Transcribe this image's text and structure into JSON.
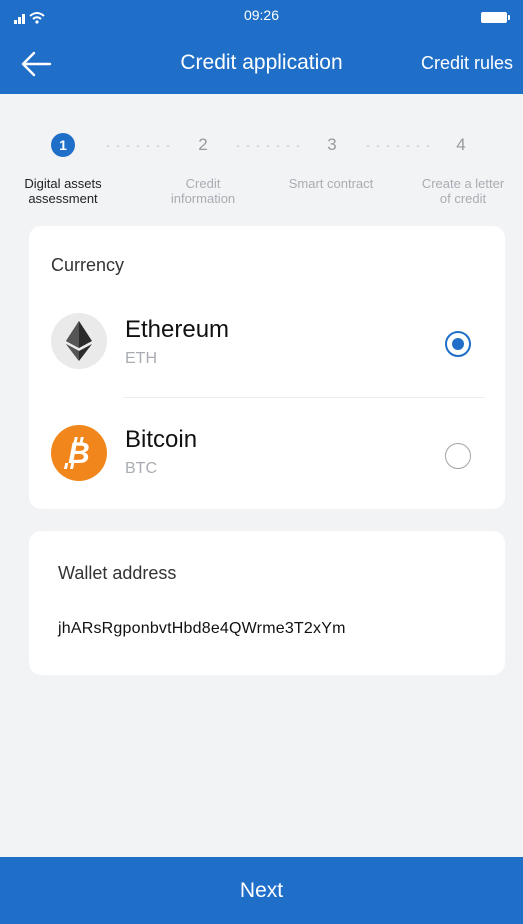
{
  "status_bar": {
    "time": "09:26"
  },
  "navbar": {
    "title": "Credit application",
    "rules_label": "Credit rules"
  },
  "steps": [
    {
      "number": "1",
      "label_line1": "Digital assets",
      "label_line2": "assessment",
      "active": true
    },
    {
      "number": "2",
      "label_line1": "Credit",
      "label_line2": "information",
      "active": false
    },
    {
      "number": "3",
      "label_line1": "Smart contract",
      "label_line2": "",
      "active": false
    },
    {
      "number": "4",
      "label_line1": "Create a letter",
      "label_line2": "of credit",
      "active": false
    }
  ],
  "currency": {
    "heading": "Currency",
    "options": [
      {
        "name": "Ethereum",
        "symbol": "ETH",
        "icon": "ethereum-icon",
        "selected": true
      },
      {
        "name": "Bitcoin",
        "symbol": "BTC",
        "icon": "bitcoin-icon",
        "selected": false
      }
    ]
  },
  "wallet": {
    "heading": "Wallet address",
    "address": "jhARsRgponbvtHbd8e4QWrme3T2xYm"
  },
  "next_label": "Next",
  "colors": {
    "primary": "#1f6fc9",
    "bitcoin": "#f1861c",
    "background": "#f2f3f5"
  }
}
